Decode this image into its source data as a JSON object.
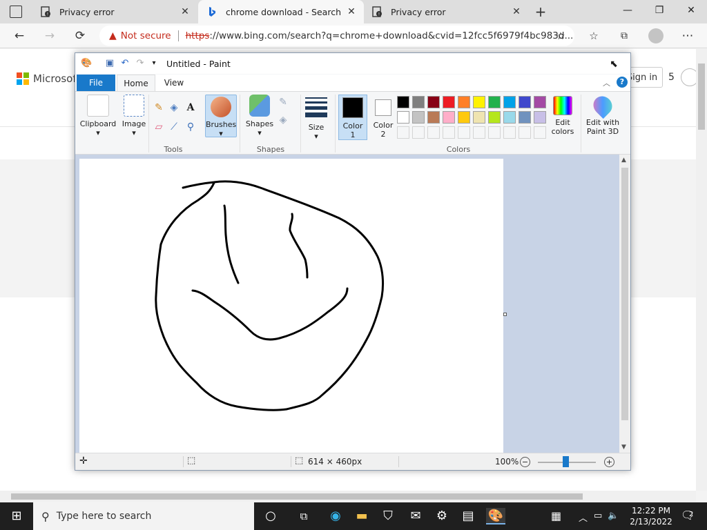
{
  "browser": {
    "tabs": [
      {
        "title": "Privacy error",
        "active": false
      },
      {
        "title": "chrome download - Search",
        "active": true
      },
      {
        "title": "Privacy error",
        "active": false
      }
    ],
    "new_tab": "+",
    "window_controls": {
      "minimize": "—",
      "restore": "❐",
      "close": "✕"
    },
    "address": {
      "security_label": "Not secure",
      "url_scheme": "https",
      "url_rest": "://www.bing.com/search?q=chrome+download&cvid=12fcc5f6979f4bc983d..."
    }
  },
  "page": {
    "logo_text": "Microsoft",
    "signin_label": "Sign in",
    "reward_count": "5"
  },
  "paint": {
    "window_title": "Untitled - Paint",
    "menu": {
      "file": "File",
      "home": "Home",
      "view": "View"
    },
    "groups": {
      "clipboard": "Clipboard",
      "image": "Image",
      "tools": "Tools",
      "brushes": "Brushes",
      "shapes_btn": "Shapes",
      "shapes_group": "Shapes",
      "size": "Size",
      "color1_a": "Color",
      "color1_b": "1",
      "color2_a": "Color",
      "color2_b": "2",
      "colors_group": "Colors",
      "edit_colors_a": "Edit",
      "edit_colors_b": "colors",
      "paint3d_a": "Edit with",
      "paint3d_b": "Paint 3D"
    },
    "palette_row1": [
      "#000000",
      "#7f7f7f",
      "#880015",
      "#ed1c24",
      "#ff7f27",
      "#fff200",
      "#22b14c",
      "#00a2e8",
      "#3f48cc",
      "#a349a4"
    ],
    "palette_row2": [
      "#ffffff",
      "#c3c3c3",
      "#b97a57",
      "#ffaec9",
      "#ffc90e",
      "#efe4b0",
      "#b5e61d",
      "#99d9ea",
      "#7092be",
      "#c8bfe7"
    ],
    "status": {
      "dimensions": "614 × 460px",
      "zoom": "100%"
    }
  },
  "taskbar": {
    "search_placeholder": "Type here to search",
    "time": "12:22 PM",
    "date": "2/13/2022",
    "notification_count": "2"
  }
}
